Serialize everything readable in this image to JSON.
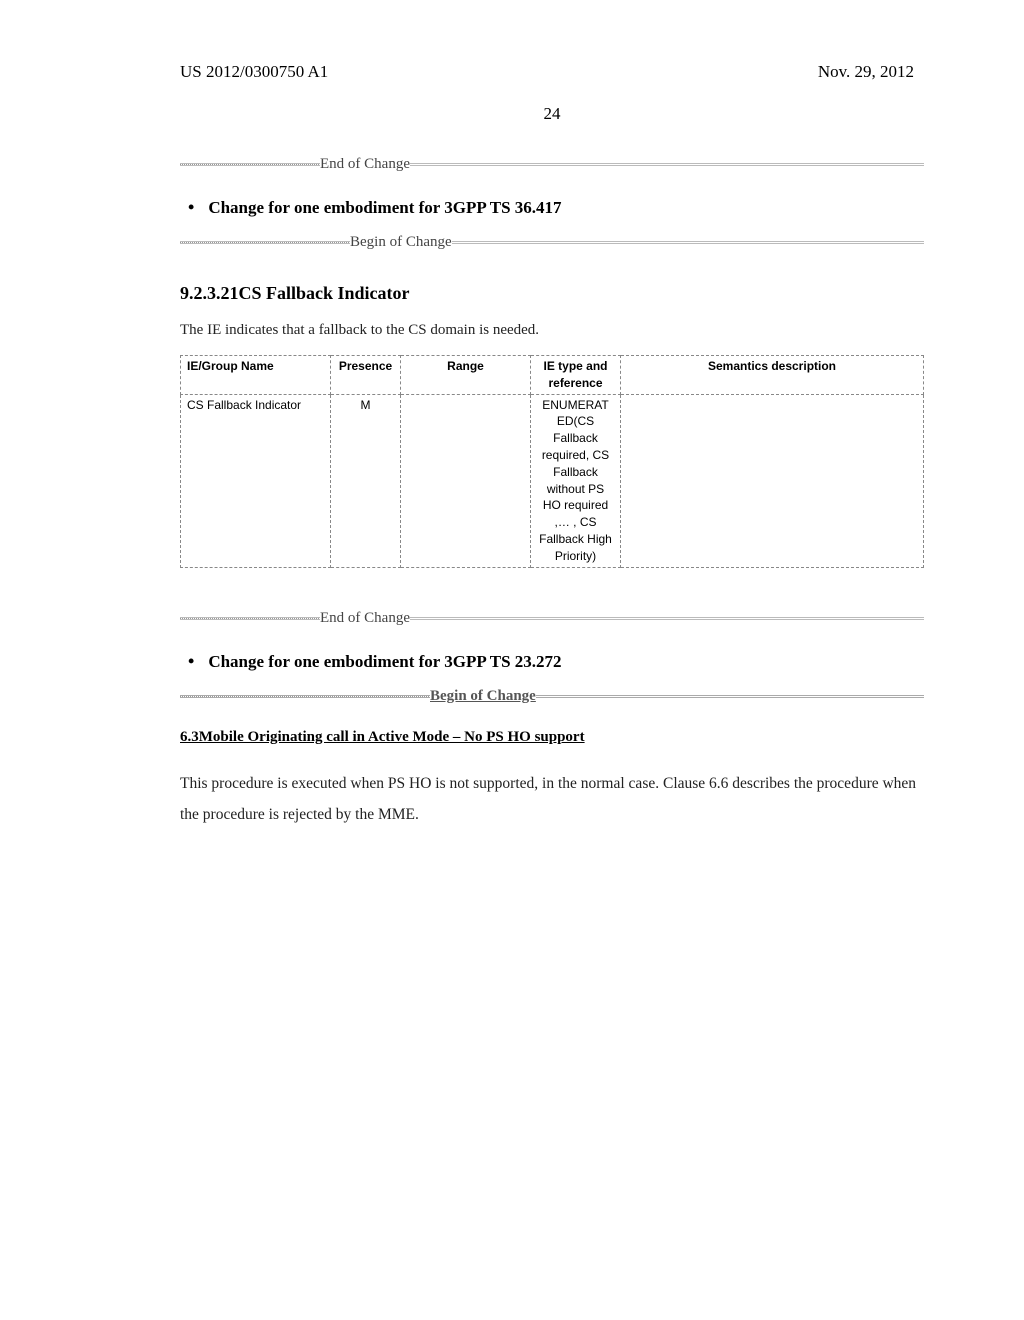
{
  "header": {
    "pubNumber": "US 2012/0300750 A1",
    "pubDate": "Nov. 29, 2012",
    "pageNumber": "24"
  },
  "dividers": {
    "endOfChange": "End of Change",
    "beginOfChange": "Begin of Change",
    "endOfChange2": "End of Change",
    "beginOfChange2": "Begin of Change"
  },
  "bulletHeadings": {
    "change36417": "Change for one embodiment for 3GPP TS 36.417",
    "change23272": "Change for one embodiment for 3GPP TS 23.272"
  },
  "section9": {
    "heading": "9.2.3.21CS Fallback Indicator",
    "intro": "The IE indicates that a fallback to the CS domain is needed."
  },
  "ieTable": {
    "headers": {
      "name": "IE/Group Name",
      "presence": "Presence",
      "range": "Range",
      "ietype": "IE type and reference",
      "semantics": "Semantics description"
    },
    "row": {
      "name": "CS Fallback Indicator",
      "presence": "M",
      "range": "",
      "ietype": "ENUMERAT ED(CS Fallback required, CS Fallback without PS HO required ,… , CS Fallback High Priority)",
      "semantics": ""
    }
  },
  "section63": {
    "heading": "6.3Mobile Originating call in Active Mode – No PS HO support",
    "para": "This procedure is executed when PS HO is not supported, in the normal case. Clause 6.6 describes the procedure when the procedure is rejected by the MME."
  }
}
